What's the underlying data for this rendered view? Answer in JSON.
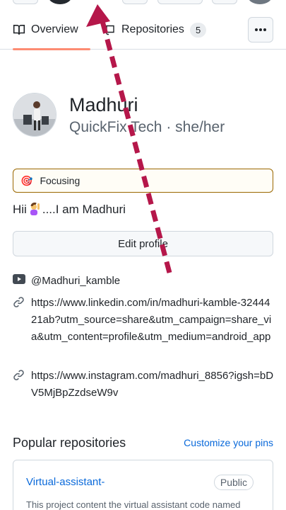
{
  "tabs": {
    "overview_label": "Overview",
    "repositories_label": "Repositories",
    "repositories_count": "5"
  },
  "profile": {
    "name": "Madhuri",
    "company": "QuickFix Tech",
    "pronouns": "she/her",
    "status_emoji": "🎯",
    "status_text": "Focusing",
    "bio_prefix": "Hii",
    "bio_suffix": "....I am Madhuri",
    "edit_button": "Edit profile"
  },
  "links": {
    "youtube": "@Madhuri_kamble",
    "linkedin": "https://www.linkedin.com/in/madhuri-kamble-3244421ab?utm_source=share&utm_campaign=share_via&utm_content=profile&utm_medium=android_app",
    "instagram": "https://www.instagram.com/madhuri_8856?igsh=bDV5MjBpZzdseW9v"
  },
  "popular": {
    "title": "Popular repositories",
    "customize": "Customize your pins",
    "repo": {
      "name": "Virtual-assistant-",
      "visibility": "Public",
      "description": "This project content the virtual assistant code named"
    }
  },
  "colors": {
    "accent_link": "#0969da",
    "tab_underline": "#fd8c73",
    "status_border": "#9a6700",
    "annotation_arrow": "#b5174a"
  },
  "icons": [
    "book-icon",
    "repo-icon",
    "kebab-icon",
    "youtube-icon",
    "link-icon",
    "target-emoji-icon",
    "person-raising-hand-emoji-icon"
  ]
}
